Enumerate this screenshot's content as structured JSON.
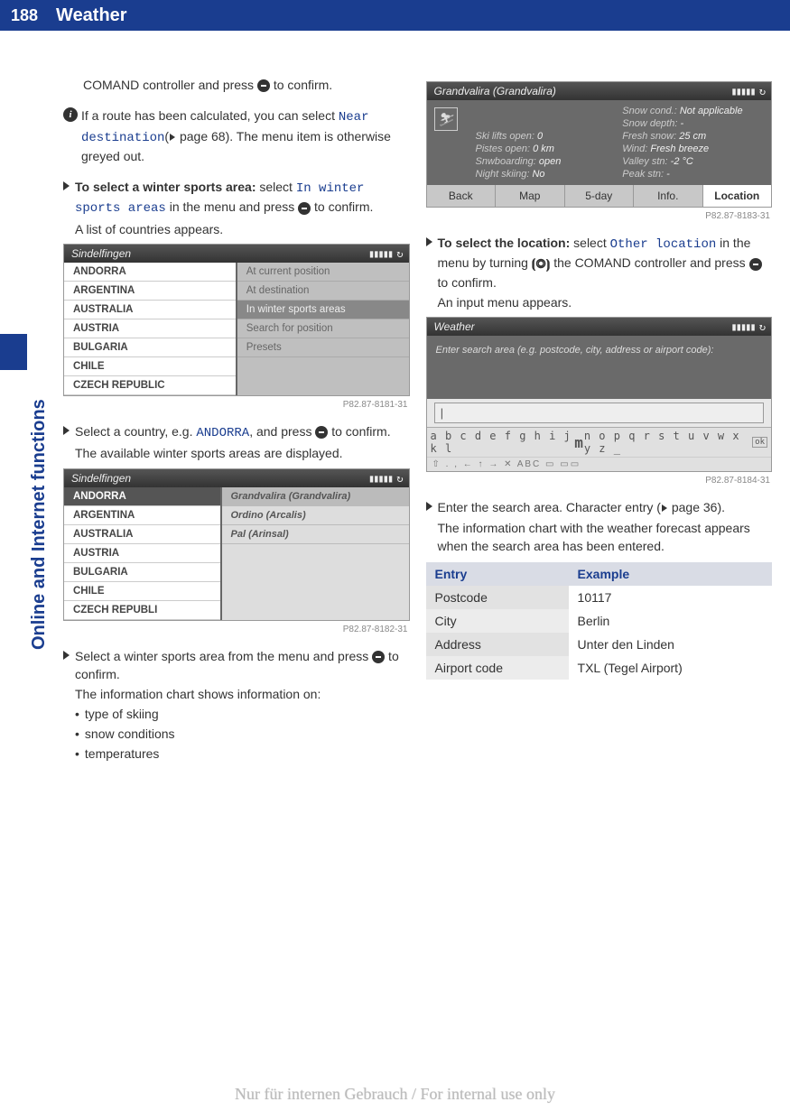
{
  "header": {
    "page": "188",
    "title": "Weather"
  },
  "sideTab": "Online and Internet functions",
  "left": {
    "p1a": "COMAND controller and press ",
    "p1b": " to confirm.",
    "infoA": "If a route has been calculated, you can select ",
    "infoHl": "Near destination",
    "infoB": "(",
    "infoC": " page 68). The menu item is otherwise greyed out.",
    "step1bold": "To select a winter sports area:",
    "step1a": " select ",
    "step1hl": "In winter sports areas",
    "step1b": " in the menu and press ",
    "step1c": " to confirm.",
    "step1result": "A list of countries appears.",
    "ss1": {
      "title": "Sindelfingen",
      "list": [
        "ANDORRA",
        "ARGENTINA",
        "AUSTRALIA",
        "AUSTRIA",
        "BULGARIA",
        "CHILE",
        "CZECH REPUBLIC"
      ],
      "menu": [
        "At current position",
        "At destination",
        "In winter sports areas",
        "Search for position",
        "Presets"
      ],
      "menuSelIdx": 2,
      "caption": "P82.87-8181-31"
    },
    "step2a": "Select a country, e.g. ",
    "step2hl": "ANDORRA",
    "step2b": ", and press ",
    "step2c": " to confirm.",
    "step2result": "The available winter sports areas are displayed.",
    "ss2": {
      "title": "Sindelfingen",
      "list": [
        "ANDORRA",
        "ARGENTINA",
        "AUSTRALIA",
        "AUSTRIA",
        "BULGARIA",
        "CHILE",
        "CZECH REPUBLI"
      ],
      "sub": [
        "Grandvalira (Grandvalira)",
        "Ordino (Arcalis)",
        "Pal (Arinsal)"
      ],
      "caption": "P82.87-8182-31"
    },
    "step3a": "Select a winter sports area from the menu and press ",
    "step3b": " to confirm.",
    "step3result": "The information chart shows information on:",
    "bullets": [
      "type of skiing",
      "snow conditions",
      "temperatures"
    ]
  },
  "right": {
    "wx": {
      "title": "Grandvalira (Grandvalira)",
      "rows": [
        [
          "Snow cond.:",
          "Not applicable"
        ],
        [
          "Snow depth:",
          "-"
        ],
        [
          "Ski lifts open:",
          "0",
          "Fresh snow:",
          "25 cm"
        ],
        [
          "Pistes open:",
          "0 km",
          "Wind:",
          "Fresh breeze"
        ],
        [
          "Snwboarding:",
          "open",
          "Valley stn:",
          "-2 °C"
        ],
        [
          "Night skiing:",
          "No",
          "Peak stn:",
          "-"
        ]
      ],
      "bar": [
        "Back",
        "Map",
        "5-day",
        "Info.",
        "Location"
      ],
      "barSelIdx": 4,
      "caption": "P82.87-8183-31"
    },
    "step1bold": "To select the location:",
    "step1a": " select ",
    "step1hl": "Other location",
    "step1b": " in the menu by turning ",
    "step1c": " the COMAND controller and press ",
    "step1d": " to confirm.",
    "step1result": "An input menu appears.",
    "srch": {
      "title": "Weather",
      "prompt": "Enter search area (e.g. postcode, city, address or airport code):",
      "field": "|",
      "kb": "a b c d e f g h i j k l",
      "kbBig": "m",
      "kb2": "n o p q r s t u v w x y z _",
      "kbOk": "ok",
      "kbRow2": "⇧  . , ← ↑ → ✕  ABC  ▭  ▭▭",
      "caption": "P82.87-8184-31"
    },
    "step2a": "Enter the search area. Character entry (",
    "step2b": " page 36).",
    "step2result": "The information chart with the weather forecast appears when the search area has been entered.",
    "table": {
      "headers": [
        "Entry",
        "Example"
      ],
      "rows": [
        [
          "Postcode",
          "10117"
        ],
        [
          "City",
          "Berlin"
        ],
        [
          "Address",
          "Unter den Linden"
        ],
        [
          "Airport code",
          "TXL (Tegel Airport)"
        ]
      ]
    }
  },
  "footer": "Nur für internen Gebrauch / For internal use only"
}
